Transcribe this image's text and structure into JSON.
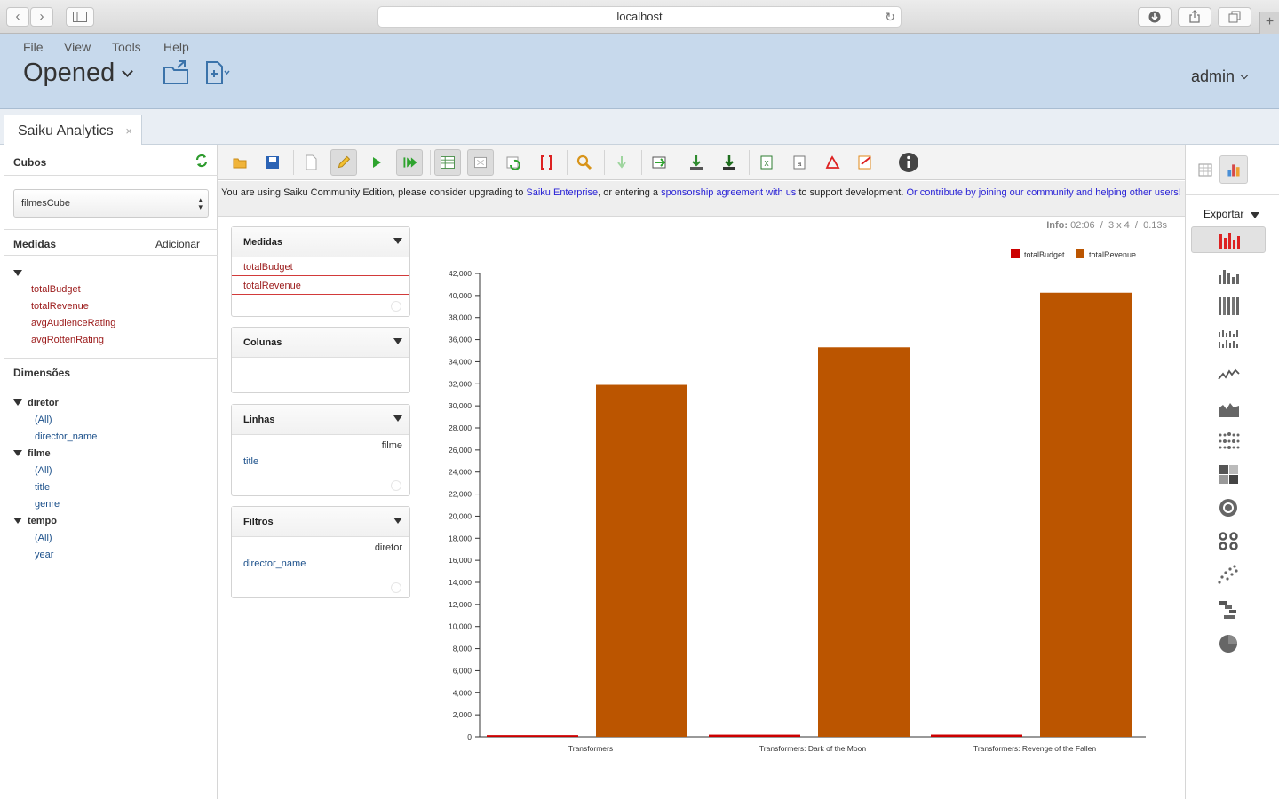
{
  "browser": {
    "url": "localhost",
    "back_icon": "chevron-left-icon",
    "forward_icon": "chevron-right-icon"
  },
  "menu": {
    "file": "File",
    "view": "View",
    "tools": "Tools",
    "help": "Help"
  },
  "header": {
    "title": "Opened",
    "user": "admin"
  },
  "tab": {
    "label": "Saiku Analytics",
    "close": "×"
  },
  "left": {
    "cubes_label": "Cubos",
    "cube_selected": "filmesCube",
    "measures_label": "Medidas",
    "add_label": "Adicionar",
    "measures": [
      "totalBudget",
      "totalRevenue",
      "avgAudienceRating",
      "avgRottenRating"
    ],
    "dimensions_label": "Dimensões",
    "dimensions": [
      {
        "name": "diretor",
        "levels": [
          "(All)",
          "director_name"
        ]
      },
      {
        "name": "filme",
        "levels": [
          "(All)",
          "title",
          "genre"
        ]
      },
      {
        "name": "tempo",
        "levels": [
          "(All)",
          "year"
        ]
      }
    ]
  },
  "notice": {
    "text1": "You are using Saiku Community Edition, please consider upgrading to ",
    "link1": "Saiku Enterprise",
    "text2": ", or entering a ",
    "link2": "sponsorship agreement with us",
    "text3": " to support development. ",
    "link3": "Or contribute by joining our community and helping other users!"
  },
  "zones": {
    "measures": {
      "title": "Medidas",
      "items": [
        "totalBudget",
        "totalRevenue"
      ]
    },
    "columns": {
      "title": "Colunas"
    },
    "rows": {
      "title": "Linhas",
      "dimension": "filme",
      "level": "title"
    },
    "filters": {
      "title": "Filtros",
      "dimension": "diretor",
      "level": "director_name"
    }
  },
  "info": {
    "label": "Info:",
    "time": "02:06",
    "size": "3 x 4",
    "duration": "0.13s"
  },
  "right": {
    "export_label": "Exportar"
  },
  "colors": {
    "budget": "#cc0000",
    "revenue": "#bb5500"
  },
  "chart_data": {
    "type": "bar",
    "categories": [
      "Transformers",
      "Transformers: Dark of the Moon",
      "Transformers: Revenge of the Fallen"
    ],
    "series": [
      {
        "name": "totalBudget",
        "values": [
          150,
          195,
          200
        ]
      },
      {
        "name": "totalRevenue",
        "values": [
          31900,
          35300,
          40250
        ]
      }
    ],
    "ylim": [
      0,
      42000
    ],
    "yticks": [
      0,
      2000,
      4000,
      6000,
      8000,
      10000,
      12000,
      14000,
      16000,
      18000,
      20000,
      22000,
      24000,
      26000,
      28000,
      30000,
      32000,
      34000,
      36000,
      38000,
      40000,
      42000
    ],
    "legend": "top-right",
    "grid": false
  }
}
